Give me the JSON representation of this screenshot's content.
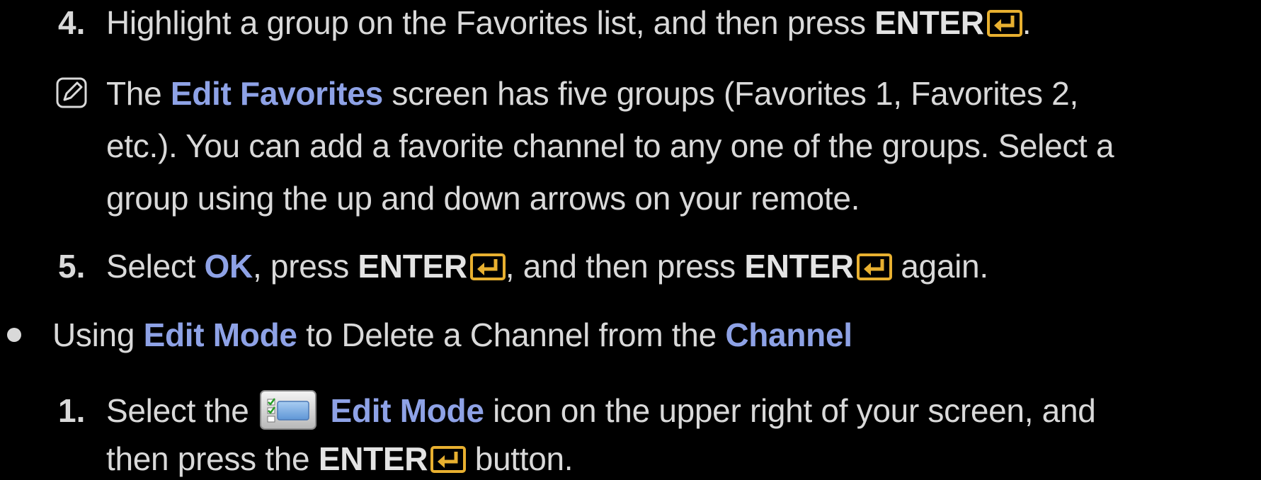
{
  "step4": {
    "number": "4.",
    "text": "Highlight a group on the Favorites list, and then press",
    "enter": "ENTER",
    "end": "."
  },
  "note": {
    "pre": "The",
    "link": "Edit Favorites",
    "line1_rest": "screen has five groups (Favorites 1, Favorites 2,",
    "line2": "etc.). You can add a favorite channel to any one of the groups. Select a",
    "line3": "group using the up and down arrows on your remote."
  },
  "step5": {
    "number": "5.",
    "pre": "Select",
    "ok": "OK",
    "mid1": ", press",
    "enter1": "ENTER",
    "mid2": ", and then press",
    "enter2": "ENTER",
    "end": "again."
  },
  "bullet": {
    "pre": "Using",
    "mode": "Edit Mode",
    "mid": "to Delete a Channel from the",
    "channel": "Channel"
  },
  "step1": {
    "number": "1.",
    "pre": "Select the",
    "mode": "Edit Mode",
    "rest": "icon on the upper right of your screen, and",
    "line2_pre": "then press the",
    "enter": "ENTER",
    "line2_end": "button."
  },
  "colors": {
    "background": "#000000",
    "text": "#d9d9d9",
    "highlight": "#8ea2e6",
    "enter_icon": "#e8b030"
  },
  "icons": {
    "enter": "enter-key-icon",
    "note": "note-pencil-icon",
    "edit_mode": "edit-mode-icon"
  }
}
